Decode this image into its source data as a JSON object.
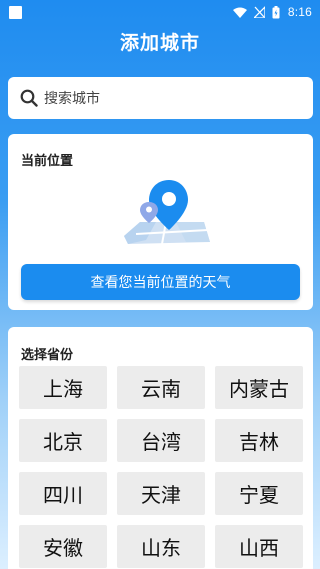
{
  "status_bar": {
    "time": "8:16"
  },
  "header": {
    "title": "添加城市"
  },
  "search": {
    "placeholder": "搜索城市"
  },
  "location": {
    "section_title": "当前位置",
    "button_label": "查看您当前位置的天气"
  },
  "provinces": {
    "section_title": "选择省份",
    "items": [
      {
        "label": "上海"
      },
      {
        "label": "云南"
      },
      {
        "label": "内蒙古"
      },
      {
        "label": "北京"
      },
      {
        "label": "台湾"
      },
      {
        "label": "吉林"
      },
      {
        "label": "四川"
      },
      {
        "label": "天津"
      },
      {
        "label": "宁夏"
      },
      {
        "label": "安徽"
      },
      {
        "label": "山东"
      },
      {
        "label": "山西"
      }
    ]
  },
  "colors": {
    "accent": "#1b8cef",
    "header_gradient_top": "#1f8cf0",
    "tile_bg": "#ececec"
  }
}
